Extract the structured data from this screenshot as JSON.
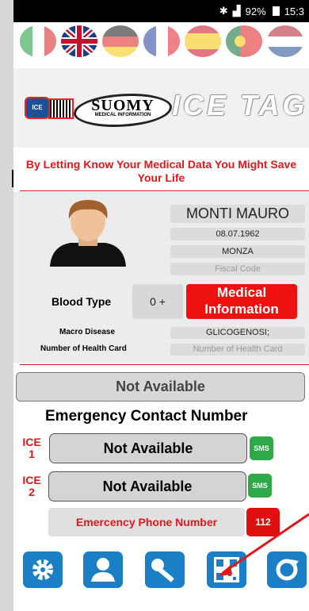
{
  "status_bar": {
    "battery": "92%",
    "time": "15:3"
  },
  "languages": [
    {
      "name": "italian-flag",
      "selected": false
    },
    {
      "name": "english-flag",
      "selected": true
    },
    {
      "name": "german-flag",
      "selected": false
    },
    {
      "name": "french-flag",
      "selected": false
    },
    {
      "name": "spanish-flag",
      "selected": false
    },
    {
      "name": "portuguese-flag",
      "selected": false
    },
    {
      "name": "dutch-flag",
      "selected": false
    }
  ],
  "brand": {
    "ice_badge": "ICE",
    "suomy_logo": "SUOMY",
    "suomy_sub": "MEDICAL INFORMATION",
    "app_name": "ICE TAG"
  },
  "slogan": "By Letting Know Your Medical Data You Might Save Your Life",
  "profile": {
    "name": "MONTI MAURO",
    "birth_date": "08.07.1962",
    "city": "MONZA",
    "fiscal_code_placeholder": "Fiscal Code"
  },
  "blood": {
    "label": "Blood Type",
    "value": "0 +"
  },
  "medical_button": "Medical Information",
  "macro_disease": {
    "label": "Macro Disease",
    "value": "GLICOGENOSI;"
  },
  "health_card": {
    "label": "Number of Health Card",
    "placeholder": "Number of Health Card"
  },
  "main_contact": "Not Available",
  "emergency": {
    "title": "Emergency Contact Number",
    "contacts": [
      {
        "label": "ICE 1",
        "value": "Not Available",
        "sms": "SMS"
      },
      {
        "label": "ICE 2",
        "value": "Not Available",
        "sms": "SMS"
      }
    ],
    "phone_label": "Emercency Phone Number",
    "phone_number": "112"
  },
  "toolbar": [
    "gear-icon",
    "user-icon",
    "key-icon",
    "qr-code-icon",
    "refresh-icon"
  ],
  "colors": {
    "red": "#e2161b",
    "blue": "#1a7fc4",
    "green": "#2fa84a"
  }
}
